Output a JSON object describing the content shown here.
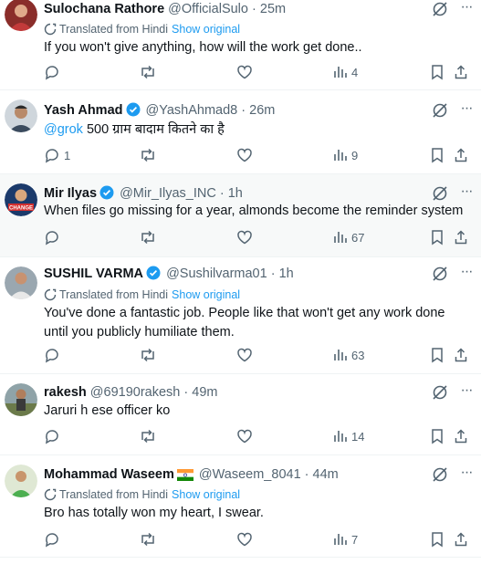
{
  "colors": {
    "accent": "#1d9bf0",
    "muted": "#536471",
    "text": "#0f1419",
    "verified": "#1d9bf0"
  },
  "translation_label": "Translated from Hindi",
  "show_original_label": "Show original",
  "tweets": [
    {
      "name": "Sulochana Rathore",
      "handle": "@OfficialSulo",
      "dot": "·",
      "time": "25m",
      "text": "If you won't give anything, how will the work get done..",
      "replies": "",
      "views": "4"
    },
    {
      "name": "Yash Ahmad",
      "handle": "@YashAhmad8",
      "dot": "·",
      "time": "26m",
      "mention": "@grok",
      "text": " 500 ग्राम बादाम कितने का है",
      "replies": "1",
      "views": "9"
    },
    {
      "name": "Mir Ilyas",
      "handle": "@Mir_Ilyas_INC",
      "dot": "·",
      "time": "1h",
      "text": "When files go missing for a year, almonds become the reminder system",
      "replies": "",
      "views": "67"
    },
    {
      "name": "SUSHIL VARMA",
      "handle": "@Sushilvarma01",
      "dot": "·",
      "time": "1h",
      "text": "You've done a fantastic job. People like that won't get any work done until you publicly humiliate them.",
      "replies": "",
      "views": "63"
    },
    {
      "name": "rakesh",
      "handle": "@69190rakesh",
      "dot": "·",
      "time": "49m",
      "text": "Jaruri h ese officer ko",
      "replies": "",
      "views": "14"
    },
    {
      "name": "Mohammad Waseem",
      "handle": "@Waseem_8041",
      "dot": "·",
      "time": "44m",
      "text": "Bro has totally won my heart, I swear.",
      "replies": "",
      "views": "7"
    }
  ]
}
